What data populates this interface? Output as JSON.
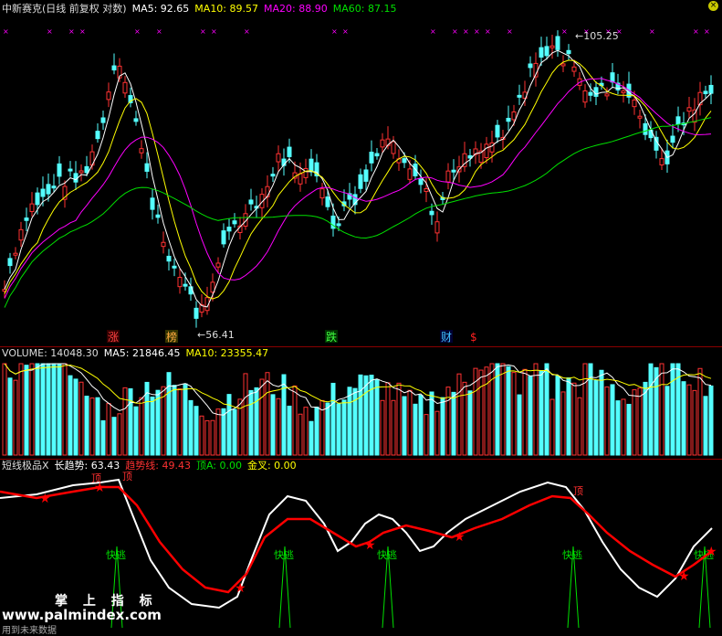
{
  "main_header": {
    "title": "中新赛克(日线 前复权 对数)",
    "ma5": "MA5: 92.65",
    "ma10": "MA10: 89.57",
    "ma20": "MA20: 88.90",
    "ma60": "MA60: 87.15"
  },
  "volume_header": {
    "volume": "VOLUME: 14048.30",
    "ma5": "MA5: 21846.45",
    "ma10": "MA10: 23355.47"
  },
  "indicator_header": {
    "name": "短线极品X",
    "long_trend": "长趋势: 63.43",
    "trend_line": "趋势线: 49.43",
    "top_a": "顶A: 0.00",
    "golden_cross": "金叉: 0.00"
  },
  "price_marks": {
    "high": "105.25",
    "low": "56.41"
  },
  "event_labels": [
    "涨",
    "榜",
    "跌",
    "财",
    "$"
  ],
  "signals": {
    "top": "顶",
    "escape": "快逃"
  },
  "watermark": {
    "line1": "掌 上 指 标",
    "line2": "www.palmindex.com",
    "line3": "用到未来数据"
  },
  "colors": {
    "up": "#ff3232",
    "down": "#54ffff",
    "ma5": "#ffffff",
    "ma10": "#ffff00",
    "ma20": "#ff00ff",
    "ma60": "#00e000",
    "trend": "#ff0000",
    "escape": "#00e000"
  },
  "chart_data": {
    "type": "candlestick",
    "ylabel_scale": "log",
    "price_high": 105.25,
    "price_low": 56.41
  }
}
